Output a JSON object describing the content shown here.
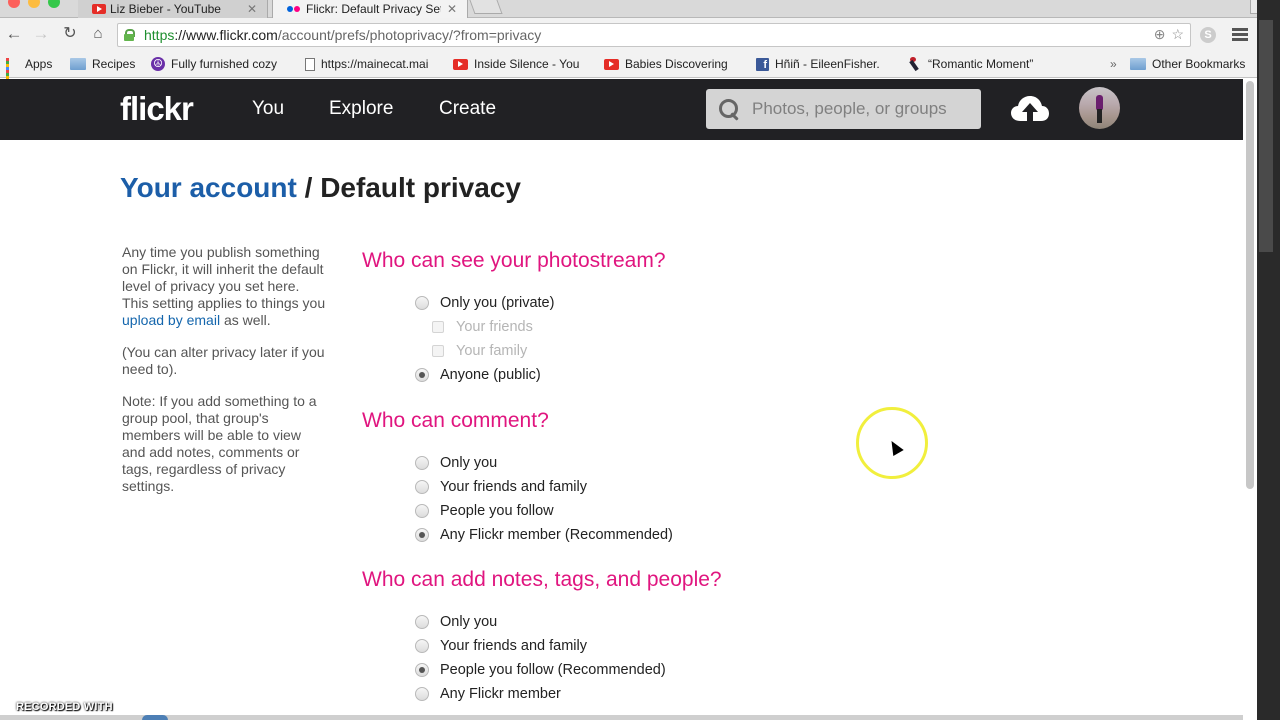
{
  "browser": {
    "tabs": [
      {
        "title": "Liz Bieber - YouTube",
        "favicon": "youtube-icon",
        "active": false
      },
      {
        "title": "Flickr: Default Privacy Sett",
        "favicon": "flickr-icon",
        "active": true
      }
    ],
    "address_bar": {
      "scheme": "https",
      "host": "://www.flickr.com",
      "path": "/account/prefs/photoprivacy/?from=privacy"
    },
    "bookmarks": [
      {
        "label": "Apps",
        "icon": "apps-grid-icon"
      },
      {
        "label": "Recipes",
        "icon": "folder-icon"
      },
      {
        "label": "Fully furnished cozy",
        "icon": "peace-icon"
      },
      {
        "label": "https://mainecat.mai",
        "icon": "page-icon"
      },
      {
        "label": "Inside Silence - You",
        "icon": "youtube-icon"
      },
      {
        "label": "Babies Discovering",
        "icon": "youtube-icon"
      },
      {
        "label": "Hñiñ - EileenFisher.",
        "icon": "facebook-icon"
      },
      {
        "label": "“Romantic Moment”",
        "icon": "bird-icon"
      }
    ],
    "bookmarks_overflow": "»",
    "other_bookmarks": "Other Bookmarks"
  },
  "flickr": {
    "logo": "flickr",
    "nav": {
      "you": "You",
      "explore": "Explore",
      "create": "Create"
    },
    "search_placeholder": "Photos, people, or groups",
    "brand_colors": {
      "pink": "#e0157f",
      "blue": "#1c5ea8",
      "nav_bg": "#212124"
    }
  },
  "page": {
    "breadcrumb_link": "Your account",
    "breadcrumb_sep": " / ",
    "title": "Default privacy",
    "sidebar": {
      "p1_before": "Any time you publish something on Flickr, it will inherit the default level of privacy you set here. This setting applies to things you ",
      "p1_link": "upload by email",
      "p1_after": " as well.",
      "p2": "(You can alter privacy later if you need to).",
      "p3": "Note: If you add something to a group pool, that group's members will be able to view and add notes, comments or tags, regardless of privacy settings."
    },
    "sections": [
      {
        "heading": "Who can see your photostream?",
        "options": [
          {
            "label": "Only you (private)",
            "checked": false
          },
          {
            "label": "Your friends",
            "checked": false,
            "sub": true
          },
          {
            "label": "Your family",
            "checked": false,
            "sub": true
          },
          {
            "label": "Anyone (public)",
            "checked": true
          }
        ]
      },
      {
        "heading": "Who can comment?",
        "options": [
          {
            "label": "Only you",
            "checked": false
          },
          {
            "label": "Your friends and family",
            "checked": false
          },
          {
            "label": "People you follow",
            "checked": false
          },
          {
            "label": "Any Flickr member (Recommended)",
            "checked": true
          }
        ]
      },
      {
        "heading": "Who can add notes, tags, and people?",
        "options": [
          {
            "label": "Only you",
            "checked": false
          },
          {
            "label": "Your friends and family",
            "checked": false
          },
          {
            "label": "People you follow (Recommended)",
            "checked": true
          },
          {
            "label": "Any Flickr member",
            "checked": false
          }
        ]
      }
    ]
  },
  "overlay": {
    "recorded_with": "RECORDED WITH"
  }
}
